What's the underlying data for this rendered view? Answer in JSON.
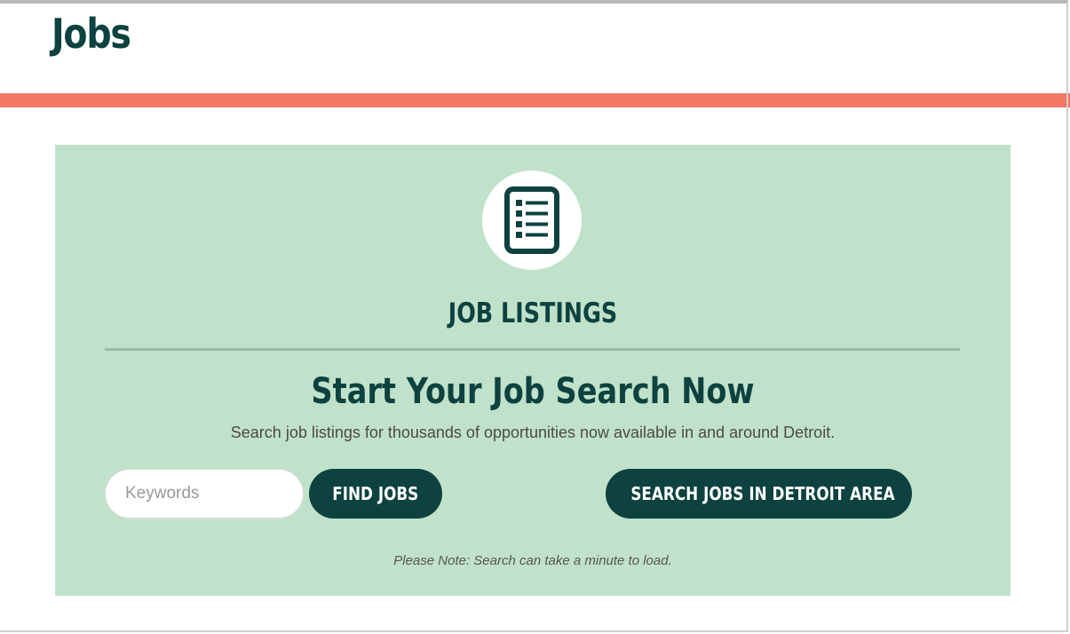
{
  "page": {
    "title": "Jobs",
    "accent_color": "#f27864"
  },
  "panel": {
    "background_color": "#c1e2ca",
    "icon": "job-list-icon",
    "heading": "JOB LISTINGS",
    "headline": "Start Your Job Search Now",
    "description": "Search job listings for thousands of opportunities now available in and around Detroit.",
    "search": {
      "placeholder": "Keywords",
      "value": "",
      "find_label": "FIND JOBS"
    },
    "area_button_label": "SEARCH JOBS IN DETROIT AREA",
    "note": "Please Note: Search can take a minute to load.",
    "button_color": "#0d4240"
  }
}
